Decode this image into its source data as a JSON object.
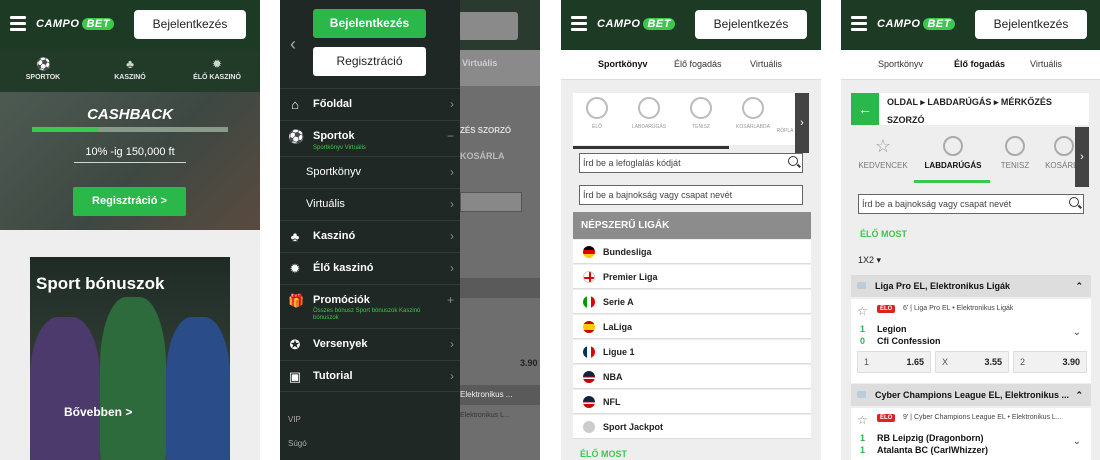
{
  "brand": {
    "left": "CAMPO",
    "right": "BET",
    "accent": "#3cc84c",
    "header_bg": "#1d3a25"
  },
  "login_label": "Bejelentkezés",
  "panel1": {
    "tabs": [
      {
        "label": "SPORTOK",
        "icon": "soccer-ball-icon"
      },
      {
        "label": "KASZINÓ",
        "icon": "club-icon"
      },
      {
        "label": "ÉLŐ KASZINÓ",
        "icon": "roulette-icon"
      }
    ],
    "hero_title": "CASHBACK",
    "hero_sub": "10% -ig 150,000 ft",
    "register": "Regisztráció >",
    "promo_title": "Sport bónuszok",
    "promo_more": "Bővebben >"
  },
  "panel2": {
    "login": "Bejelentkezés",
    "register": "Regisztráció",
    "menu": [
      {
        "label": "Főoldal",
        "icon": "home-icon",
        "sub": ""
      },
      {
        "label": "Sportok",
        "icon": "soccer-ball-icon",
        "sub": "Sportkönyv Virtuális"
      },
      {
        "label": "Sportkönyv",
        "icon": "",
        "sub": ""
      },
      {
        "label": "Virtuális",
        "icon": "",
        "sub": ""
      },
      {
        "label": "Kaszinó",
        "icon": "club-icon",
        "sub": ""
      },
      {
        "label": "Élő kaszinó",
        "icon": "roulette-icon",
        "sub": ""
      },
      {
        "label": "Promóciók",
        "icon": "gift-icon",
        "sub": "Összes bónusz Sport bónuszok Kaszinó bónuszok"
      },
      {
        "label": "Versenyek",
        "icon": "medal-icon",
        "sub": ""
      },
      {
        "label": "Tutorial",
        "icon": "tutorial-icon",
        "sub": ""
      }
    ],
    "small": [
      "VIP",
      "Súgó"
    ],
    "bg_text": {
      "tab_virtual": "Virtuális",
      "header": "ZÉS SZORZÓ",
      "kosar": "KOSÁRLA",
      "ekronikus": "Elektronikus ...",
      "ekronikus2": "Elektronikus L...",
      "odd": "3.90"
    }
  },
  "tabs": [
    "Sportkönyv",
    "Élő fogadás",
    "Virtuális"
  ],
  "panel3": {
    "sports": [
      "ÉLŐ",
      "LABDARÚGÁS",
      "TENISZ",
      "KOSÁRLABDA",
      "RÖPLA"
    ],
    "code_placeholder": "Írd be a lefoglalás kódját",
    "search_placeholder": "Írd be a bajnokság vagy csapat nevét",
    "popular_header": "NÉPSZERŰ LIGÁK",
    "leagues": [
      "Bundesliga",
      "Premier Liga",
      "Serie A",
      "LaLiga",
      "Ligue 1",
      "NBA",
      "NFL",
      "Sport Jackpot"
    ],
    "live": "ÉLŐ MOST"
  },
  "panel4": {
    "breadcrumb": "OLDAL ▸ LABDARÚGÁS ▸ MÉRKŐZÉS SZORZÓ",
    "categories": [
      "KEDVENCEK",
      "LABDARÚGÁS",
      "TENISZ",
      "KOSÁRLA"
    ],
    "search_placeholder": "Írd be a bajnokság vagy csapat nevét",
    "live": "ÉLŐ MOST",
    "market": "1X2 ▾",
    "sections": [
      {
        "title": "Liga Pro EL, Elektronikus Ligák",
        "live": "ÉLŐ",
        "minute": "6' | Liga Pro EL • Elektronikus Ligák",
        "score1": "1",
        "team1": "Legion",
        "score2": "0",
        "team2": "Cfi Confession",
        "odds": [
          {
            "k": "1",
            "v": "1.65"
          },
          {
            "k": "X",
            "v": "3.55"
          },
          {
            "k": "2",
            "v": "3.90"
          }
        ]
      },
      {
        "title": "Cyber Champions League EL, Elektronikus ...",
        "live": "ÉLŐ",
        "minute": "9' | Cyber Champions League EL • Elektronikus L...",
        "score1": "1",
        "team1": "RB Leipzig (Dragonborn)",
        "score2": "1",
        "team2": "Atalanta BC (CarlWhizzer)",
        "odds": []
      }
    ]
  }
}
